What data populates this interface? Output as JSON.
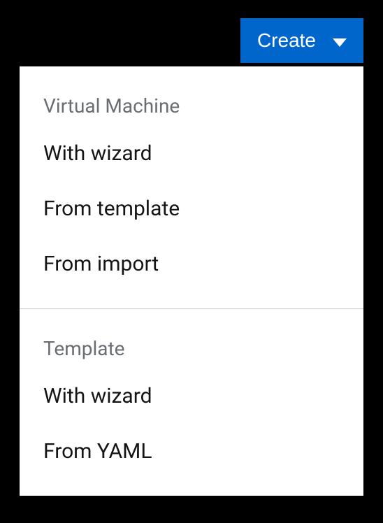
{
  "button": {
    "label": "Create"
  },
  "menu": {
    "sections": [
      {
        "header": "Virtual Machine",
        "items": [
          {
            "label": "With wizard"
          },
          {
            "label": "From template"
          },
          {
            "label": "From import"
          }
        ]
      },
      {
        "header": "Template",
        "items": [
          {
            "label": "With wizard"
          },
          {
            "label": "From YAML"
          }
        ]
      }
    ]
  }
}
